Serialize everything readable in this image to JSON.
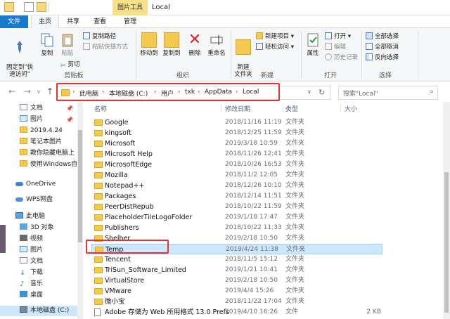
{
  "window": {
    "title": "Local",
    "tools_tab": "图片工具",
    "tools_subtab": "管理"
  },
  "ribbon_tabs": [
    "文件",
    "主页",
    "共享",
    "查看"
  ],
  "ribbon": {
    "clipboard": {
      "pin_label": "固定到\"快\n速访问\"",
      "copy_label": "复制",
      "paste_label": "粘贴",
      "copy_path": "复制路径",
      "paste_shortcut": "粘贴快捷方式",
      "cut": "剪切",
      "group": "剪贴板"
    },
    "organize": {
      "move_to": "移动到",
      "copy_to": "复制到",
      "delete": "删除",
      "rename": "重命名",
      "group": "组织"
    },
    "new": {
      "new_folder": "新建\n文件夹",
      "new_item": "新建项目",
      "easy_access": "轻松访问",
      "group": "新建"
    },
    "open": {
      "properties": "属性",
      "open": "打开",
      "edit": "编辑",
      "history": "历史记录",
      "group": "打开"
    },
    "select": {
      "select_all": "全部选择",
      "select_none": "全部取消",
      "invert": "反向选择",
      "group": "选择"
    }
  },
  "address": {
    "crumbs": [
      "此电脑",
      "本地磁盘 (C:)",
      "用户",
      "txk",
      "AppData",
      "Local"
    ],
    "search_placeholder": "搜索\"Local\""
  },
  "navpane": {
    "quick_access": [
      "文档",
      "图片",
      "2019.4.24",
      "笔记本图片",
      "教你隐藏电脑上",
      "使用Windows自"
    ],
    "onedrive": "OneDrive",
    "wps": "WPS网盘",
    "thispc": "此电脑",
    "pc_items": [
      "3D 对象",
      "视频",
      "图片",
      "文档",
      "下载",
      "音乐",
      "桌面",
      "本地磁盘 (C:)"
    ]
  },
  "columns": {
    "name": "名称",
    "date": "修改日期",
    "type": "类型",
    "size": "大小"
  },
  "files": [
    {
      "name": "Google",
      "date": "2018/11/16 11:19",
      "type": "文件夹",
      "size": ""
    },
    {
      "name": "kingsoft",
      "date": "2018/12/25 11:59",
      "type": "文件夹",
      "size": ""
    },
    {
      "name": "Microsoft",
      "date": "2019/3/18 10:59",
      "type": "文件夹",
      "size": ""
    },
    {
      "name": "Microsoft Help",
      "date": "2018/11/26 12:41",
      "type": "文件夹",
      "size": ""
    },
    {
      "name": "MicrosoftEdge",
      "date": "2018/10/26 16:53",
      "type": "文件夹",
      "size": ""
    },
    {
      "name": "Mozilla",
      "date": "2018/11/2 12:05",
      "type": "文件夹",
      "size": ""
    },
    {
      "name": "Notepad++",
      "date": "2018/12/26 10:10",
      "type": "文件夹",
      "size": ""
    },
    {
      "name": "Packages",
      "date": "2018/12/14 11:51",
      "type": "文件夹",
      "size": ""
    },
    {
      "name": "PeerDistRepub",
      "date": "2018/10/22 11:59",
      "type": "文件夹",
      "size": ""
    },
    {
      "name": "PlaceholderTileLogoFolder",
      "date": "2019/1/18 17:47",
      "type": "文件夹",
      "size": ""
    },
    {
      "name": "Publishers",
      "date": "2018/10/22 11:33",
      "type": "文件夹",
      "size": ""
    },
    {
      "name": "Shelher",
      "date": "2019/2/18 10:50",
      "type": "文件夹",
      "size": ""
    },
    {
      "name": "Temp",
      "date": "2019/4/24 11:38",
      "type": "文件夹",
      "size": ""
    },
    {
      "name": "Tencent",
      "date": "2018/11/5 15:12",
      "type": "文件夹",
      "size": ""
    },
    {
      "name": "TriSun_Software_Limited",
      "date": "2019/1/21 10:41",
      "type": "文件夹",
      "size": ""
    },
    {
      "name": "VirtualStore",
      "date": "2019/2/18 10:50",
      "type": "文件夹",
      "size": ""
    },
    {
      "name": "VMware",
      "date": "2019/4/4 15:26",
      "type": "文件夹",
      "size": ""
    },
    {
      "name": "微小宝",
      "date": "2018/11/22 17:04",
      "type": "文件夹",
      "size": ""
    },
    {
      "name": "Adobe 存储为 Web 所用格式 13.0 Prefs",
      "date": "2019/4/10 16:26",
      "type": "文件",
      "size": "2 KB"
    }
  ],
  "selected_index": 12,
  "colors": {
    "accent": "#1979ca",
    "selection": "#cce8ff",
    "highlight": "#e8322f",
    "folder": "#f3c94f"
  }
}
